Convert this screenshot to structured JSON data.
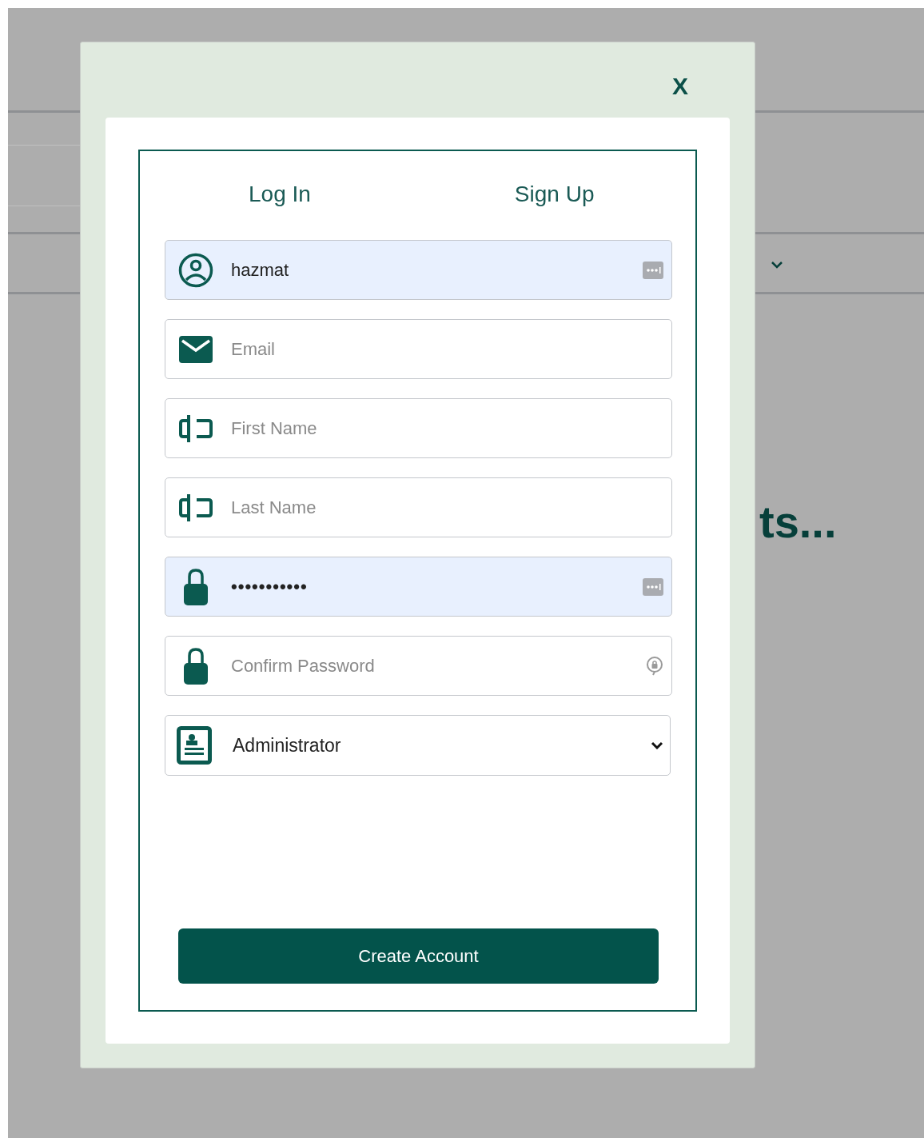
{
  "background": {
    "heading": "ts..."
  },
  "dialog": {
    "close": "X",
    "tabs": [
      {
        "label": "Log In"
      },
      {
        "label": "Sign Up"
      }
    ],
    "fields": [
      {
        "kind": "username",
        "value": "hazmat",
        "autofilled": true
      },
      {
        "kind": "email",
        "placeholder": "Email",
        "autofilled": false
      },
      {
        "kind": "first_name",
        "placeholder": "First Name",
        "autofilled": false
      },
      {
        "kind": "last_name",
        "placeholder": "Last Name",
        "autofilled": false
      },
      {
        "kind": "password",
        "value": "•••••••••••",
        "autofilled": true
      },
      {
        "kind": "confirm_password",
        "placeholder": "Confirm Password",
        "autofilled": false
      },
      {
        "kind": "role",
        "value": "Administrator"
      }
    ],
    "submit": "Create Account"
  }
}
